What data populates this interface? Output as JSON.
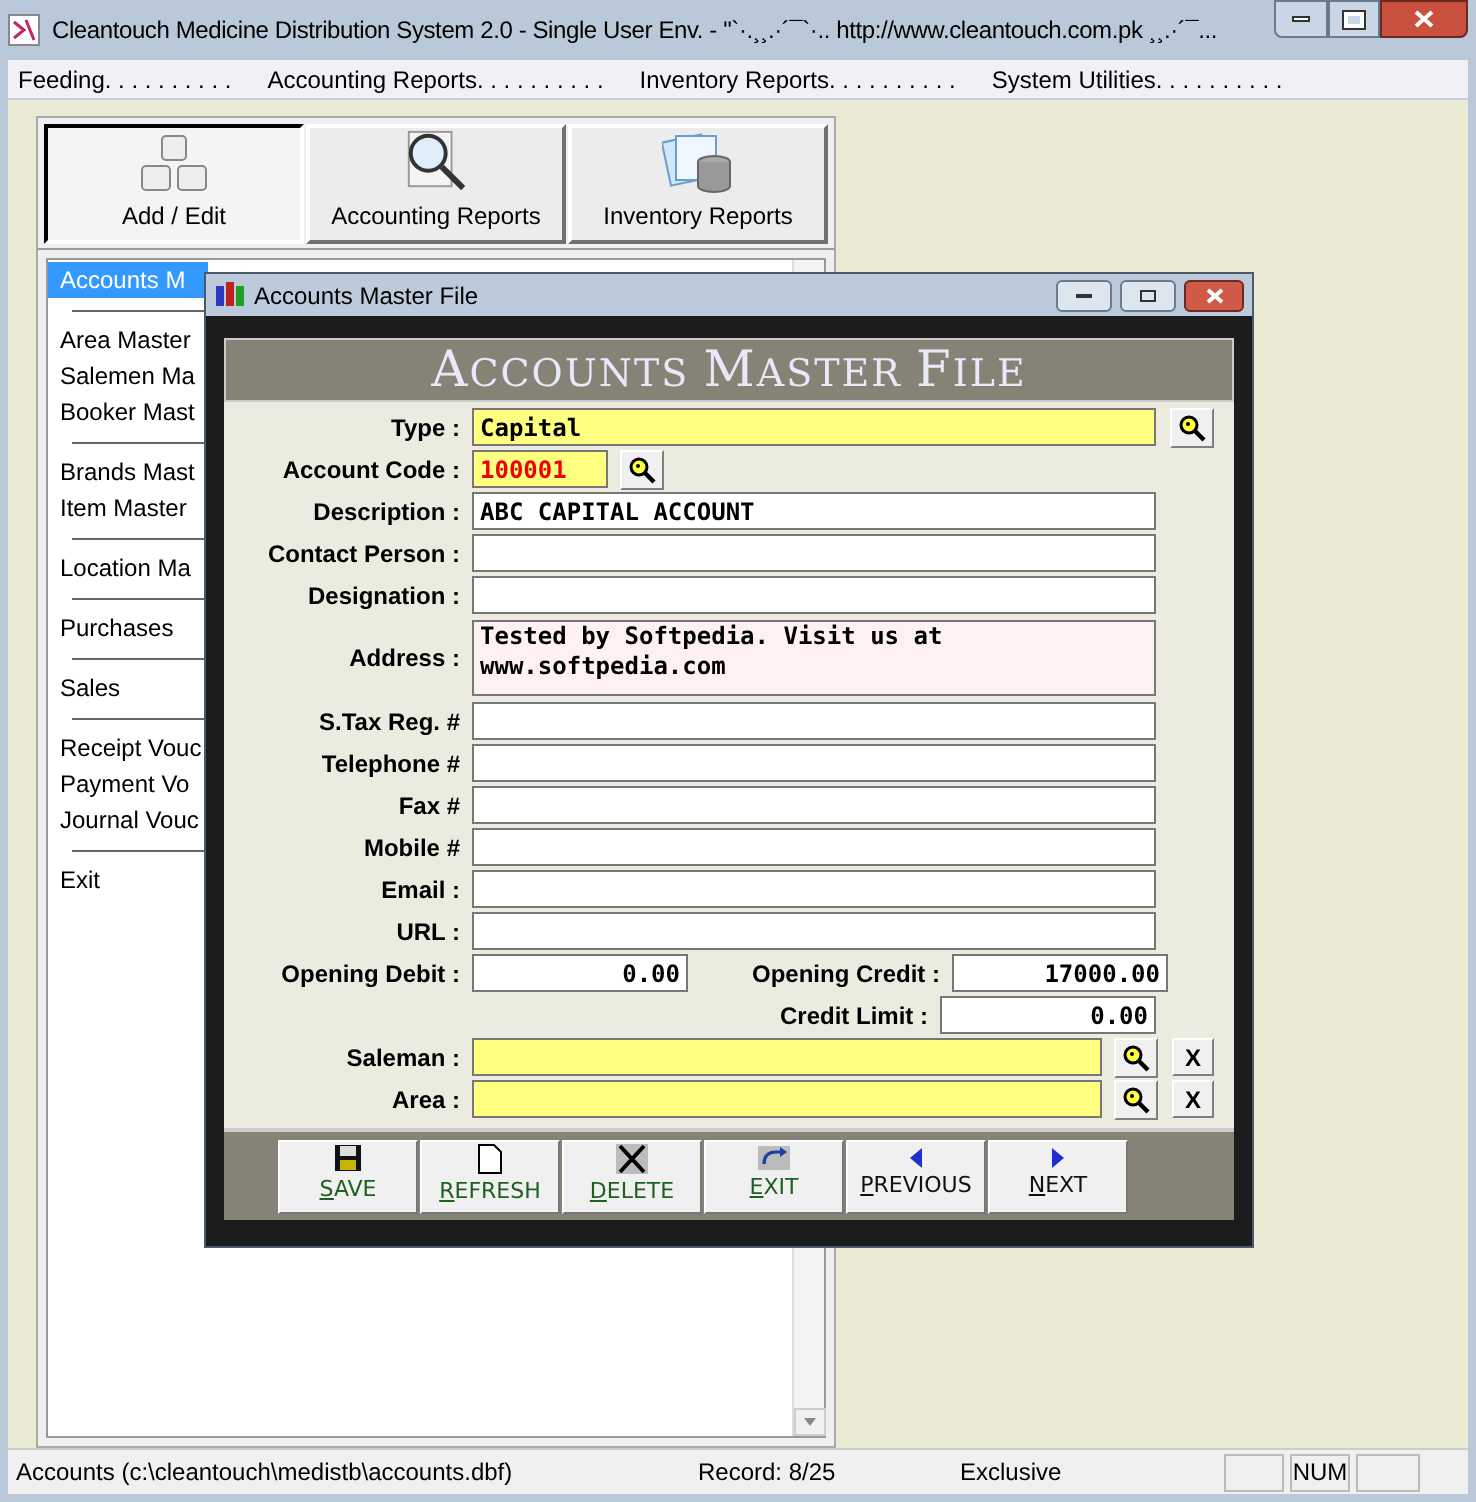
{
  "window": {
    "title": "Cleantouch Medicine Distribution System 2.0 - Single User Env.  -  \"`·.¸¸.·´¯`·.. http://www.cleantouch.com.pk ¸¸.·´¯..."
  },
  "menu": [
    "Feeding. . . . . . . . . .",
    "Accounting Reports. . . . . . . . . .",
    "Inventory Reports. . . . . . . . . .",
    "System Utilities. . . . . . . . . ."
  ],
  "toolbar": [
    {
      "label": "Add / Edit",
      "kind": "keys",
      "selected": true
    },
    {
      "label": "Accounting Reports",
      "kind": "magnifier",
      "selected": false
    },
    {
      "label": "Inventory Reports",
      "kind": "database",
      "selected": false
    }
  ],
  "sidebar": {
    "items": [
      {
        "label": "Accounts M",
        "selected": true,
        "group_start": false
      },
      {
        "label": "Area Master",
        "selected": false,
        "group_start": true
      },
      {
        "label": "Salemen Ma",
        "selected": false,
        "group_start": false
      },
      {
        "label": "Booker Mast",
        "selected": false,
        "group_start": false
      },
      {
        "label": "Brands Mast",
        "selected": false,
        "group_start": true
      },
      {
        "label": "Item Master",
        "selected": false,
        "group_start": false
      },
      {
        "label": "Location Ma",
        "selected": false,
        "group_start": true
      },
      {
        "label": "Purchases",
        "selected": false,
        "group_start": true
      },
      {
        "label": "Sales",
        "selected": false,
        "group_start": true
      },
      {
        "label": "Receipt Vouc",
        "selected": false,
        "group_start": true
      },
      {
        "label": "Payment Vo",
        "selected": false,
        "group_start": false
      },
      {
        "label": "Journal Vouc",
        "selected": false,
        "group_start": false
      },
      {
        "label": "Exit",
        "selected": false,
        "group_start": true
      }
    ]
  },
  "dialog": {
    "title": "Accounts Master File",
    "heading": "ACCOUNTS MASTER FILE",
    "fields": [
      {
        "label": "Type :",
        "value": "Capital",
        "kind": "lookup"
      },
      {
        "label": "Account Code :",
        "value": "100001",
        "kind": "code"
      },
      {
        "label": "Description :",
        "value": "ABC CAPITAL ACCOUNT",
        "kind": "text"
      },
      {
        "label": "Contact Person :",
        "kind": "text"
      },
      {
        "label": "Designation :",
        "kind": "text"
      },
      {
        "label": "Address :",
        "value": "Tested by Softpedia. Visit us at\nwww.softpedia.com",
        "kind": "memo"
      },
      {
        "label": "S.Tax Reg. #",
        "kind": "text"
      },
      {
        "label": "Telephone #",
        "kind": "text"
      },
      {
        "label": "Fax #",
        "kind": "text"
      },
      {
        "label": "Mobile #",
        "kind": "text"
      },
      {
        "label": "Email :",
        "kind": "text"
      },
      {
        "label": "URL :",
        "kind": "text"
      }
    ],
    "opening_debit": {
      "label": "Opening Debit :",
      "value": "0.00"
    },
    "opening_credit": {
      "label": "Opening Credit :",
      "value": "17000.00"
    },
    "credit_limit": {
      "label": "Credit Limit :",
      "value": "0.00"
    },
    "references": [
      {
        "label": "Saleman :",
        "clear": "X"
      },
      {
        "label": "Area :",
        "clear": "X"
      }
    ],
    "buttons": [
      {
        "label": "SAVE",
        "kind": "save"
      },
      {
        "label": "REFRESH",
        "kind": "refresh"
      },
      {
        "label": "DELETE",
        "kind": "delete"
      },
      {
        "label": "EXIT",
        "kind": "exit"
      },
      {
        "label": "PREVIOUS",
        "kind": "previous"
      },
      {
        "label": "NEXT",
        "kind": "next"
      }
    ]
  },
  "status_bar": {
    "file": "Accounts (c:\\cleantouch\\medistb\\accounts.dbf)",
    "record": "Record: 8/25",
    "mode": "Exclusive",
    "num": "NUM"
  }
}
